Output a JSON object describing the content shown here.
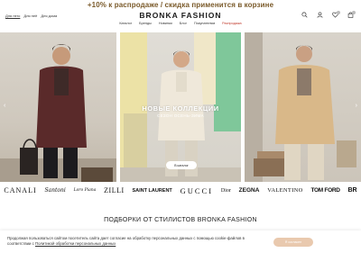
{
  "promo": {
    "text": "+10% к распродаже / скидка применится в корзине"
  },
  "header": {
    "gender_tabs": [
      "Для него",
      "Для неё",
      "Для дома"
    ],
    "logo": "BRONKA FASHION",
    "nav": [
      "Каталог",
      "Бренды",
      "Новинки",
      "Блог",
      "Покупателям",
      "Распродажа"
    ],
    "icons": [
      "search-icon",
      "user-icon",
      "heart-icon",
      "bag-icon"
    ],
    "sale_color": "#c0392b"
  },
  "hero": {
    "title": "НОВЫЕ КОЛЛЕКЦИИ",
    "subtitle": "СЕЗОН ОСЕНЬ-ЗИМА",
    "button": "В каталог",
    "prev": "‹",
    "next": "›"
  },
  "brands": [
    "CANALI",
    "Santoni",
    "Loro Piana",
    "ZILLI",
    "SAINT LAURENT",
    "GUCCI",
    "Dior",
    "ZEGNA",
    "VALENTINO",
    "TOM FORD",
    "BR"
  ],
  "section": {
    "title": "ПОДБОРКИ ОТ СТИЛИСТОВ BRONKA FASHION"
  },
  "cookie": {
    "text": "Продолжая пользоваться сайтом посетитель сайта дает согласие на обработку персональных данных с помощью cookie-файлов в соответствии с",
    "link": "Политикой обработки персональных данных",
    "button": "Я согласен",
    "button_color": "#e9c9ae"
  }
}
